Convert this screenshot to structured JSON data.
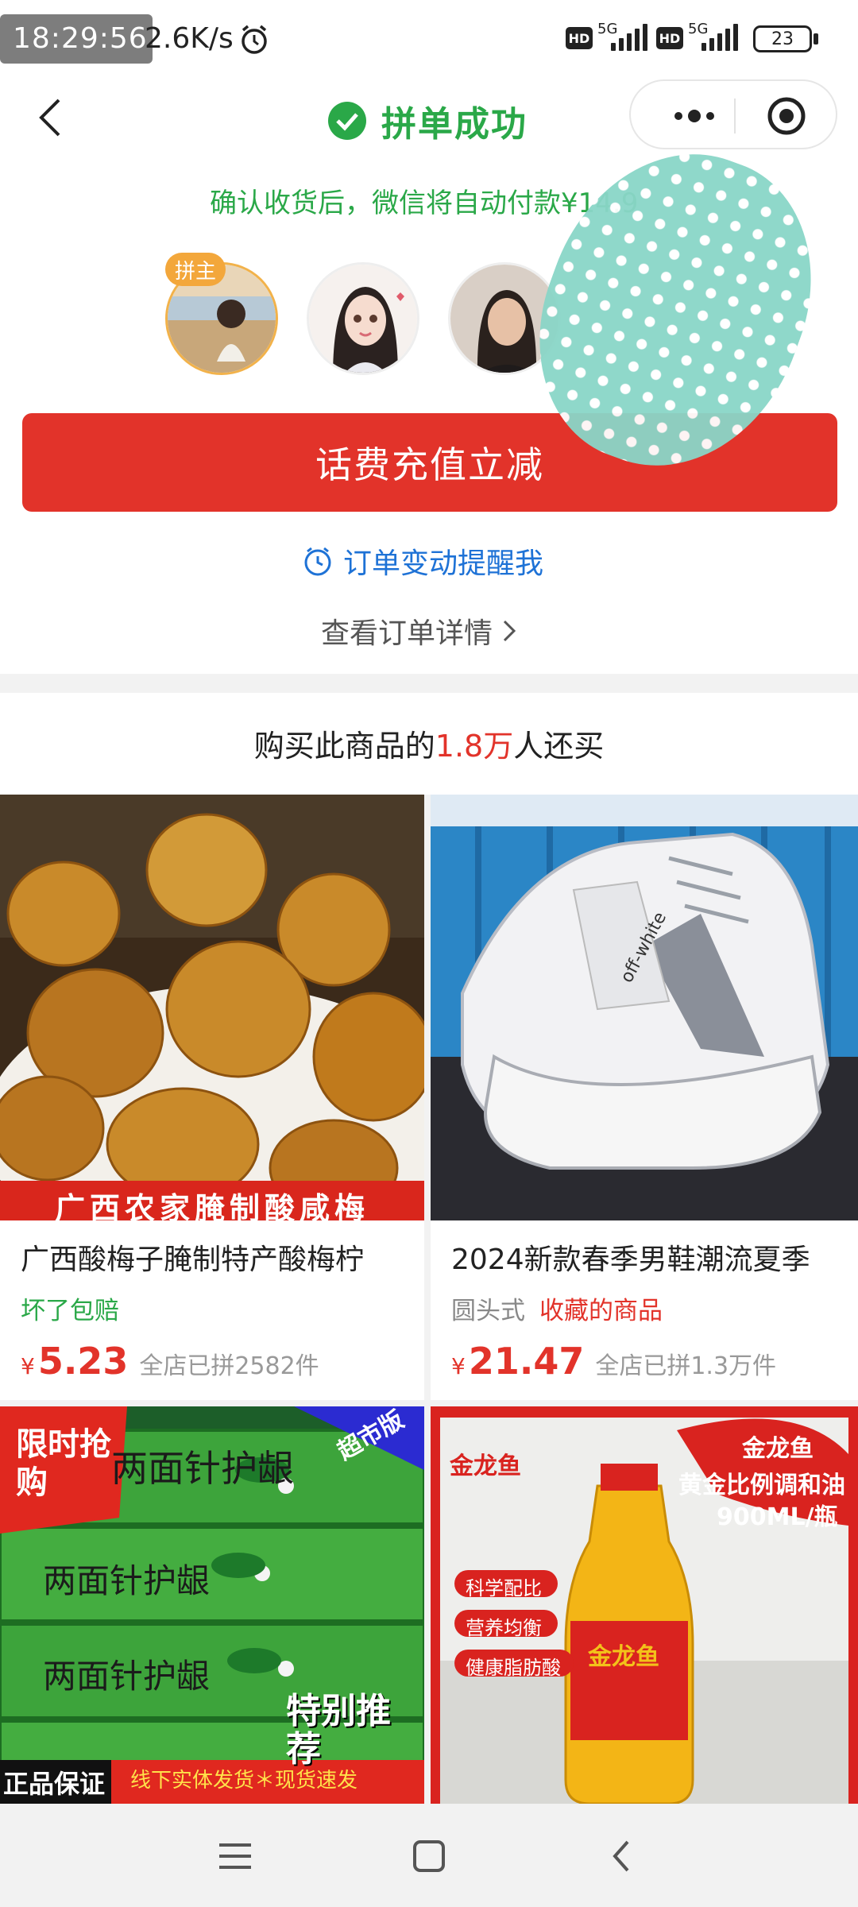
{
  "status_bar": {
    "time": "18:29:56",
    "net_speed": "2.6K/s",
    "network_1": "5G",
    "network_2": "5G",
    "hd_1": "HD",
    "hd_2": "HD",
    "battery": "23"
  },
  "header": {
    "title": "拼单成功"
  },
  "notice": "确认收货后，微信将自动付款¥14.9",
  "host_badge": "拼主",
  "cta_button": "话费充值立减",
  "remind_link": "订单变动提醒我",
  "detail_link": "查看订单详情",
  "recommend": {
    "prefix": "购买此商品的",
    "count": "1.8万",
    "suffix": "人还买"
  },
  "products": [
    {
      "banner": "广西农家腌制酸咸梅",
      "title": "广西酸梅子腌制特产酸梅柠",
      "tags": [
        "坏了包赔"
      ],
      "price": "5.23",
      "sold": "全店已拼2582件"
    },
    {
      "title": "2024新款春季男鞋潮流夏季",
      "tags": [
        "圆头式",
        "收藏的商品"
      ],
      "price": "21.47",
      "sold": "全店已拼1.3万件",
      "shoe_text": "off-white"
    },
    {
      "badge_left": "限时抢购",
      "badge_right": "超市版",
      "box_text": "两面针护龈",
      "recommend_text": "特别推荐",
      "bottom_left": "正品保证",
      "bottom_strip": "线下实体发货＊现货速发"
    },
    {
      "brand": "金龙鱼",
      "headline_1": "金龙鱼",
      "headline_2": "黄金比例调和油",
      "headline_3": "900ML/瓶",
      "pills": [
        "科学配比",
        "营养均衡",
        "健康脂肪酸"
      ],
      "bottle_label": "金龙鱼"
    }
  ],
  "colors": {
    "success_green": "#2aa848",
    "cta_red": "#e2332a",
    "link_blue": "#1e72d6"
  }
}
